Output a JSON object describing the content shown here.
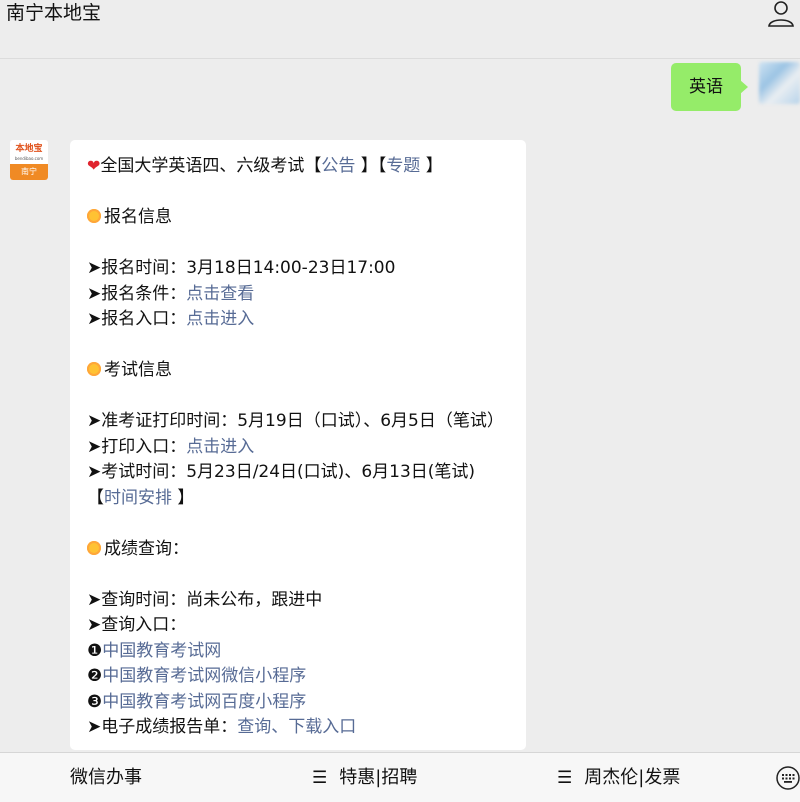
{
  "header": {
    "title": "南宁本地宝"
  },
  "outgoing": {
    "text": "英语"
  },
  "bot": {
    "avatar_logo": "本地宝",
    "avatar_url": "bendibao.com",
    "avatar_city": "南宁"
  },
  "message": {
    "line1_pre": "全国大学英语四、六级考试【",
    "line1_link1": "公告",
    "line1_mid": " 】【",
    "line1_link2": "专题",
    "line1_post": " 】",
    "sec1_title": "报名信息",
    "reg_time": "➤报名时间：3月18日14:00-23日17:00",
    "reg_cond_label": "➤报名条件：",
    "reg_cond_link": "点击查看",
    "reg_entry_label": "➤报名入口：",
    "reg_entry_link": "点击进入",
    "sec2_title": "考试信息",
    "admit_time": "➤准考证打印时间：5月19日（口试）、6月5日（笔试）",
    "print_entry_label": "➤打印入口：",
    "print_entry_link": "点击进入",
    "exam_time": "➤考试时间：5月23日/24日(口试)、6月13日(笔试)",
    "schedule_pre": "【",
    "schedule_link": "时间安排",
    "schedule_post": " 】",
    "sec3_title": "成绩查询：",
    "query_time": "➤查询时间：尚未公布，跟进中",
    "query_entry": "➤查询入口：",
    "q1_num": "❶",
    "q1_link": "中国教育考试网",
    "q2_num": "❷",
    "q2_link": "中国教育考试网微信小程序",
    "q3_num": "❸",
    "q3_link": "中国教育考试网百度小程序",
    "report_label": "➤电子成绩报告单：",
    "report_link": "查询、下载入口"
  },
  "footer": {
    "menu1": "微信办事",
    "menu2": "特惠|招聘",
    "menu3": "周杰伦|发票",
    "menu_icon": "hamburger-icon"
  },
  "colors": {
    "link": "#576b95",
    "outgoing_bubble": "#95ec69",
    "background": "#ededed"
  }
}
